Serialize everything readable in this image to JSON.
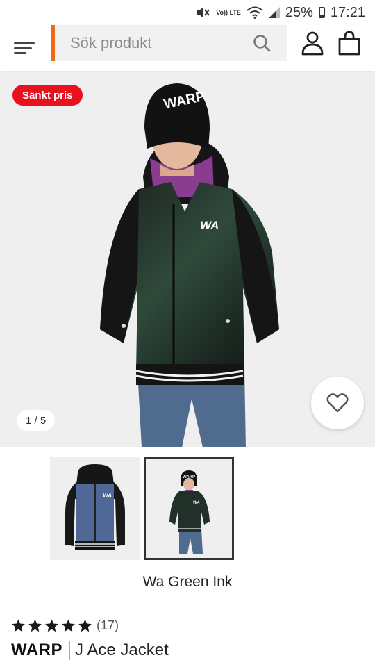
{
  "status_bar": {
    "volte_top": "Vo))",
    "volte_bottom": "LTE",
    "battery": "25%",
    "time": "17:21",
    "icons": [
      "mute-icon",
      "volte-icon",
      "wifi-icon",
      "signal-icon",
      "battery-icon"
    ]
  },
  "header": {
    "search_placeholder": "Sök produkt",
    "accent_color": "#f06a14",
    "icons": [
      "menu-icon",
      "search-icon",
      "account-icon",
      "cart-icon"
    ]
  },
  "product_image": {
    "badge": "Sänkt pris",
    "badge_color": "#e8111d",
    "counter": "1 / 5",
    "beanie_text": "WARP",
    "jacket_logo": "WA"
  },
  "thumbnails": [
    {
      "logo": "WA",
      "selected": false
    },
    {
      "logo": "WA",
      "beanie_text": "WARP",
      "selected": true
    }
  ],
  "variant": {
    "name": "Wa Green Ink"
  },
  "rating": {
    "stars": 5,
    "count": "(17)"
  },
  "product": {
    "brand": "WARP",
    "name": "J Ace Jacket"
  }
}
